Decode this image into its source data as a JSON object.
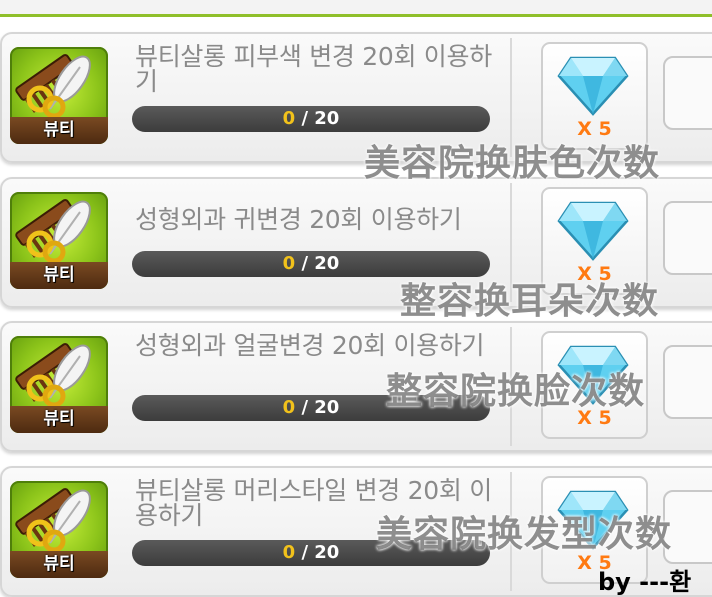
{
  "quests": [
    {
      "category": "뷰티",
      "title": "뷰티살롱 피부색 변경 20회 이용하기",
      "progress_current": "0",
      "progress_separator": " / ",
      "progress_total": "20",
      "reward_quantity": "X 5",
      "reward_icon": "diamond-icon",
      "overlay_text": "美容院换肤色次数"
    },
    {
      "category": "뷰티",
      "title": "성형외과 귀변경 20회 이용하기",
      "progress_current": "0",
      "progress_separator": " / ",
      "progress_total": "20",
      "reward_quantity": "X 5",
      "reward_icon": "diamond-icon",
      "overlay_text": "整容换耳朵次数"
    },
    {
      "category": "뷰티",
      "title": "성형외과 얼굴변경 20회 이용하기",
      "progress_current": "0",
      "progress_separator": " / ",
      "progress_total": "20",
      "reward_quantity": "X 5",
      "reward_icon": "diamond-icon",
      "overlay_text": "整容院换脸次数"
    },
    {
      "category": "뷰티",
      "title": "뷰티살롱 머리스타일 변경 20회 이용하기",
      "progress_current": "0",
      "progress_separator": " / ",
      "progress_total": "20",
      "reward_quantity": "X 5",
      "reward_icon": "diamond-icon",
      "overlay_text": "美容院换发型次数"
    }
  ],
  "credit": "by ---환",
  "colors": {
    "accent_green": "#8fbf2a",
    "progress_current": "#f2c21b",
    "reward_quantity": "#ff7a12",
    "diamond": "#5fd0f0"
  }
}
